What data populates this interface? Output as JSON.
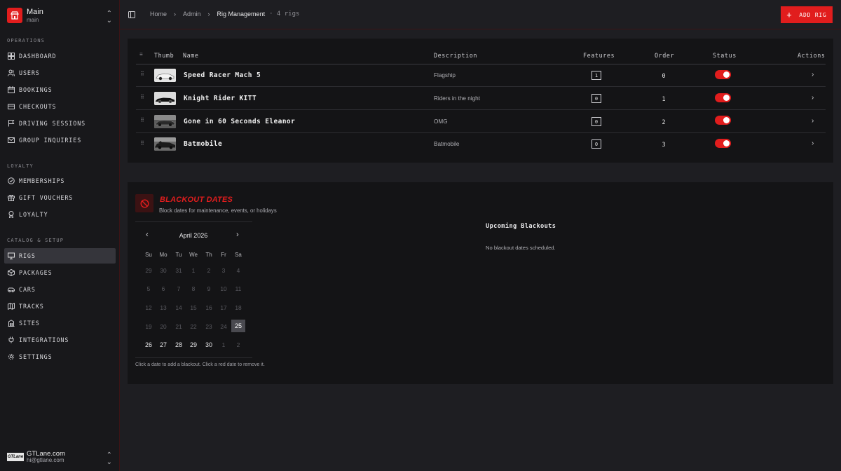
{
  "brand": {
    "title": "Main",
    "subtitle": "main"
  },
  "sidebar": {
    "sections": [
      {
        "label": "OPERATIONS",
        "items": [
          "DASHBOARD",
          "USERS",
          "BOOKINGS",
          "CHECKOUTS",
          "DRIVING SESSIONS",
          "GROUP INQUIRIES"
        ]
      },
      {
        "label": "LOYALTY",
        "items": [
          "MEMBERSHIPS",
          "GIFT VOUCHERS",
          "LOYALTY"
        ]
      },
      {
        "label": "CATALOG & SETUP",
        "items": [
          "RIGS",
          "PACKAGES",
          "CARS",
          "TRACKS",
          "SITES",
          "INTEGRATIONS",
          "SETTINGS"
        ]
      }
    ],
    "active_item": "RIGS"
  },
  "account": {
    "logo": "GTLane",
    "name": "GTLane.com",
    "email": "hi@gtlane.com"
  },
  "breadcrumb": {
    "items": [
      "Home",
      "Admin",
      "Rig Management"
    ],
    "count": "4 rigs"
  },
  "toolbar": {
    "add_label": "ADD RIG"
  },
  "table": {
    "headers": [
      "Thumb",
      "Name",
      "Description",
      "Features",
      "Order",
      "Status",
      "Actions"
    ],
    "rows": [
      {
        "name": "Speed Racer Mach 5",
        "description": "Flagship",
        "features": "1",
        "order": "0",
        "status": true
      },
      {
        "name": "Knight Rider KITT",
        "description": "Riders in the night",
        "features": "0",
        "order": "1",
        "status": true
      },
      {
        "name": "Gone in 60 Seconds Eleanor",
        "description": "OMG",
        "features": "0",
        "order": "2",
        "status": true
      },
      {
        "name": "Batmobile",
        "description": "Batmobile",
        "features": "0",
        "order": "3",
        "status": true
      }
    ]
  },
  "blackout": {
    "title": "BLACKOUT DATES",
    "subtitle": "Block dates for maintenance, events, or holidays",
    "calendar": {
      "month": "April 2026",
      "weekdays": [
        "Su",
        "Mo",
        "Tu",
        "We",
        "Th",
        "Fr",
        "Sa"
      ],
      "weeks": [
        [
          "29",
          "30",
          "31",
          "1",
          "2",
          "3",
          "4"
        ],
        [
          "5",
          "6",
          "7",
          "8",
          "9",
          "10",
          "11"
        ],
        [
          "12",
          "13",
          "14",
          "15",
          "16",
          "17",
          "18"
        ],
        [
          "19",
          "20",
          "21",
          "22",
          "23",
          "24",
          "25"
        ],
        [
          "26",
          "27",
          "28",
          "29",
          "30",
          "1",
          "2"
        ]
      ],
      "today": "25",
      "hint": "Click a date to add a blackout. Click a red date to remove it."
    },
    "upcoming_title": "Upcoming Blackouts",
    "upcoming_empty": "No blackout dates scheduled."
  },
  "colors": {
    "accent": "#e11d1d",
    "background": "#1e1e22",
    "panel": "#141416",
    "sidebar": "#18181b"
  }
}
